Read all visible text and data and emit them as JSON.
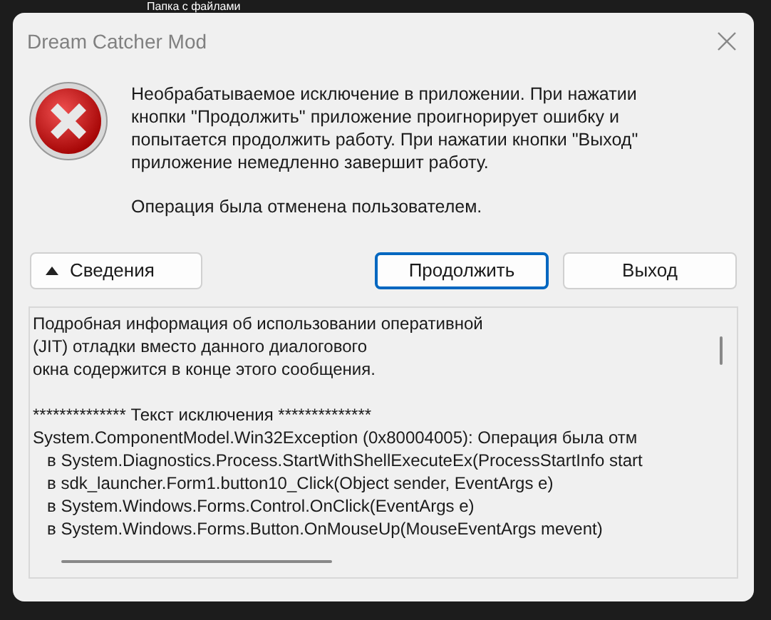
{
  "background": {
    "label": "Папка с файлами"
  },
  "window": {
    "title": "Dream Catcher Mod"
  },
  "message": {
    "paragraphs": [
      [
        "Необрабатываемое исключение в приложении. При нажатии",
        "кнопки \"Продолжить\" приложение проигнорирует ошибку и",
        "попытается продолжить работу. При нажатии кнопки \"Выход\"",
        "приложение немедленно завершит работу."
      ],
      [
        "Операция была отменена пользователем."
      ]
    ]
  },
  "details_button": {
    "label": "Сведения",
    "expanded": true
  },
  "buttons": [
    {
      "label": "Продолжить",
      "selected": true
    },
    {
      "label": "Выход",
      "selected": false
    }
  ],
  "details": {
    "paragraphs": [
      [
        "Подробная информация об использовании оперативной",
        "(JIT) отладки вместо данного диалогового",
        "окна содержится в конце этого сообщения."
      ],
      [
        "************** Текст исключения **************",
        "System.ComponentModel.Win32Exception (0x80004005): Операция была отм",
        "   в System.Diagnostics.Process.StartWithShellExecuteEx(ProcessStartInfo start",
        "   в sdk_launcher.Form1.button10_Click(Object sender, EventArgs e)",
        "   в System.Windows.Forms.Control.OnClick(EventArgs e)",
        "   в System.Windows.Forms.Button.OnMouseUp(MouseEventArgs mevent)"
      ]
    ]
  }
}
